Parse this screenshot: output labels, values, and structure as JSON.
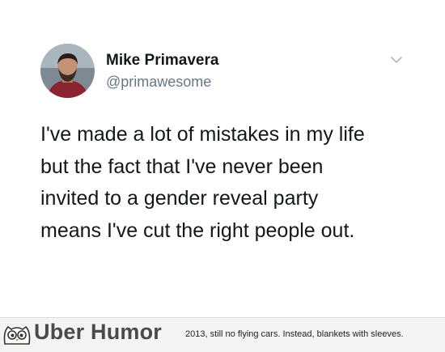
{
  "tweet": {
    "author_name": "Mike Primavera",
    "author_handle": "@primawesome",
    "text_lines": [
      "I've made a lot of mistakes in my life",
      "but the fact that I've never been",
      "invited to a gender reveal party",
      "means I've cut the right people out."
    ],
    "menu_icon": "chevron-down-icon",
    "avatar_icon": "user-avatar"
  },
  "footer": {
    "brand": "Uber Humor",
    "logo_icon": "owl-icon",
    "tagline": "2013, still no flying cars. Instead, blankets with sleeves."
  },
  "colors": {
    "name": "#14171a",
    "handle": "#657786",
    "footer_bg": "#f4f4f4",
    "brand": "#4a4a4a"
  }
}
